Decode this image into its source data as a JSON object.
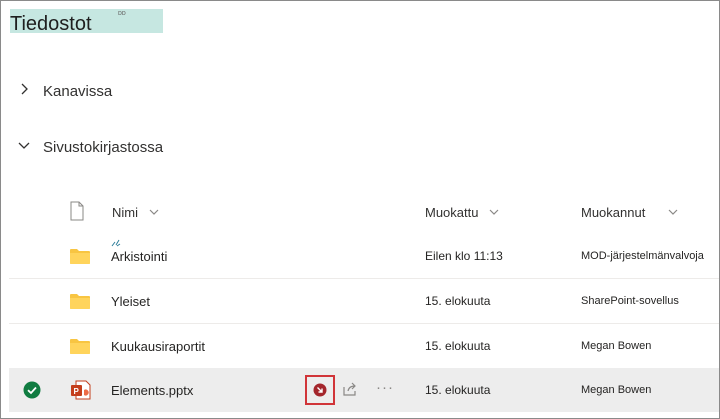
{
  "page": {
    "title": "Tiedostot",
    "title_mark": "ᴅᴅ"
  },
  "sections": [
    {
      "label": "Kanavissa",
      "expanded": false,
      "icon": "chevron-right-icon"
    },
    {
      "label": "Sivustokirjastossa",
      "expanded": true,
      "icon": "chevron-down-icon"
    }
  ],
  "columns": {
    "name": "Nimi",
    "modified": "Muokattu",
    "modified_by": "Muokannut"
  },
  "rows": [
    {
      "name": "Arkistointi",
      "type": "folder",
      "modified": "Eilen klo 11:13",
      "modified_by": "MOD-järjestelmänvalvoja"
    },
    {
      "name": "Yleiset",
      "type": "folder",
      "modified": "15. elokuuta",
      "modified_by": "SharePoint-sovellus"
    },
    {
      "name": "Kuukausiraportit",
      "type": "folder",
      "modified": "15. elokuuta",
      "modified_by": "Megan Bowen"
    },
    {
      "name": "Elements.pptx",
      "type": "pptx",
      "modified": "15. elokuuta",
      "modified_by": "Megan Bowen",
      "selected": true
    }
  ],
  "colors": {
    "folder": "#f8c542",
    "title_highlight": "#c6e7e1",
    "selected_row": "#ededed",
    "check": "#107c41",
    "ppt": "#c43e1c",
    "action_border": "#d13438"
  }
}
